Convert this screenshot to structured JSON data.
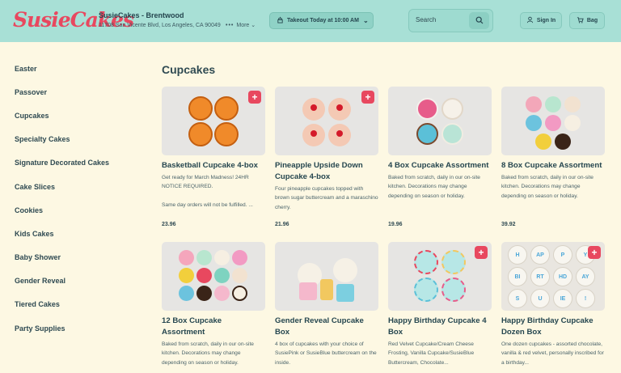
{
  "header": {
    "logo": "SusieCakes",
    "store_name": "SusieCakes - Brentwood",
    "store_address": "11708 San Vicente Blvd, Los Angeles, CA 90049",
    "more_label": "More",
    "takeout_label": "Takeout Today at 10:00 AM",
    "search_placeholder": "Search",
    "signin_label": "Sign In",
    "bag_label": "Bag"
  },
  "sidebar": {
    "items": [
      {
        "label": "Easter"
      },
      {
        "label": "Passover"
      },
      {
        "label": "Cupcakes"
      },
      {
        "label": "Specialty Cakes"
      },
      {
        "label": "Signature Decorated Cakes"
      },
      {
        "label": "Cake Slices"
      },
      {
        "label": "Cookies"
      },
      {
        "label": "Kids Cakes"
      },
      {
        "label": "Baby Shower"
      },
      {
        "label": "Gender Reveal"
      },
      {
        "label": "Tiered Cakes"
      },
      {
        "label": "Party Supplies"
      }
    ]
  },
  "main": {
    "section_title": "Cupcakes",
    "products": [
      {
        "title": "Basketball Cupcake 4-box",
        "desc": "Get ready for March Madness! 24HR NOTICE REQUIRED.\n\nSame day orders will not be fulfilled. ...",
        "price": "23.96",
        "add": "+"
      },
      {
        "title": "Pineapple Upside Down Cupcake 4-box",
        "desc": "Four pineapple cupcakes topped with brown sugar buttercream and a maraschino cherry.",
        "price": "21.96",
        "add": "+"
      },
      {
        "title": "4 Box Cupcake Assortment",
        "desc": "Baked from scratch, daily in our on-site kitchen. Decorations may change depending on season or holiday.",
        "price": "19.96",
        "add": ""
      },
      {
        "title": "8 Box Cupcake Assortment",
        "desc": "Baked from scratch, daily in our on-site kitchen. Decorations may change depending on season or holiday.",
        "price": "39.92",
        "add": ""
      },
      {
        "title": "12 Box Cupcake Assortment",
        "desc": "Baked from scratch, daily in our on-site kitchen. Decorations may change depending on season or holiday.",
        "price": "",
        "add": ""
      },
      {
        "title": "Gender Reveal Cupcake Box",
        "desc": "4 box of cupcakes with your choice of SusiePink or SusieBlue buttercream on the inside.",
        "price": "",
        "add": ""
      },
      {
        "title": "Happy Birthday Cupcake 4 Box",
        "desc": "Red Velvet Cupcake/Cream Cheese Frosting, Vanilla Cupcake/SusieBlue Buttercream, Chocolate...",
        "price": "",
        "add": "+"
      },
      {
        "title": "Happy Birthday Cupcake Dozen Box",
        "desc": "One dozen cupcakes - assorted chocolate, vanilla & red velvet, personally inscribed for a birthday...",
        "price": "",
        "add": "+"
      }
    ],
    "letters": [
      "H",
      "AP",
      "P",
      "Y",
      "BI",
      "RT",
      "HD",
      "AY",
      "S",
      "U",
      "IE",
      "!"
    ]
  },
  "colors": {
    "header_bg": "#a8e0d6",
    "brand_red": "#e8485f",
    "page_bg": "#fdf8e3"
  }
}
